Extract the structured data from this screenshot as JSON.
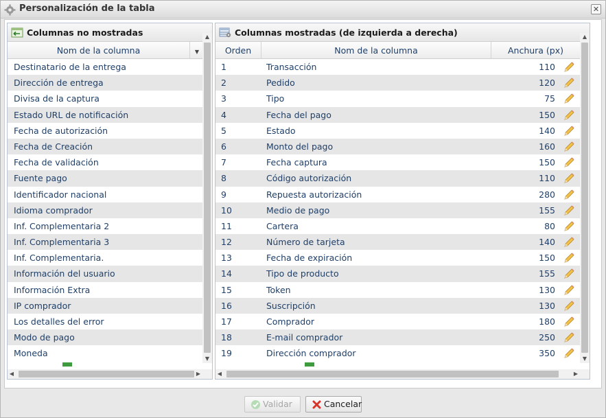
{
  "dialog": {
    "title": "Personalización de la tabla"
  },
  "hidden_panel": {
    "title": "Columnas no mostradas",
    "column_header": "Nom de la columna",
    "items": [
      "Destinatario de la entrega",
      "Dirección de entrega",
      "Divisa de la captura",
      "Estado URL de notificación",
      "Fecha de autorización",
      "Fecha de Creación",
      "Fecha de validación",
      "Fuente pago",
      "Identificador nacional",
      "Idioma comprador",
      "Inf. Complementaria 2",
      "Inf. Complementaria 3",
      "Inf. Complementaria.",
      "Información del usuario",
      "Información Extra",
      "IP comprador",
      "Los detalles del error",
      "Modo de pago",
      "Moneda"
    ]
  },
  "shown_panel": {
    "title": "Columnas mostradas (de izquierda a derecha)",
    "headers": {
      "order": "Orden",
      "name": "Nom de la columna",
      "width": "Anchura (px)"
    },
    "rows": [
      {
        "order": "1",
        "name": "Transacción",
        "width": "110"
      },
      {
        "order": "2",
        "name": "Pedido",
        "width": "120"
      },
      {
        "order": "3",
        "name": "Tipo",
        "width": "75"
      },
      {
        "order": "4",
        "name": "Fecha del pago",
        "width": "150"
      },
      {
        "order": "5",
        "name": "Estado",
        "width": "140"
      },
      {
        "order": "6",
        "name": "Monto del pago",
        "width": "160"
      },
      {
        "order": "7",
        "name": "Fecha captura",
        "width": "150"
      },
      {
        "order": "8",
        "name": "Código autorización",
        "width": "110"
      },
      {
        "order": "9",
        "name": "Repuesta autorización",
        "width": "280"
      },
      {
        "order": "10",
        "name": "Medio de pago",
        "width": "155"
      },
      {
        "order": "11",
        "name": "Cartera",
        "width": "80"
      },
      {
        "order": "12",
        "name": "Número de tarjeta",
        "width": "140"
      },
      {
        "order": "13",
        "name": "Fecha de expiración",
        "width": "150"
      },
      {
        "order": "14",
        "name": "Tipo de producto",
        "width": "155"
      },
      {
        "order": "15",
        "name": "Token",
        "width": "130"
      },
      {
        "order": "16",
        "name": "Suscripción",
        "width": "130"
      },
      {
        "order": "17",
        "name": "Comprador",
        "width": "180"
      },
      {
        "order": "18",
        "name": "E-mail comprador",
        "width": "250"
      },
      {
        "order": "19",
        "name": "Dirección comprador",
        "width": "350"
      }
    ]
  },
  "buttons": {
    "validate": "Validar",
    "cancel": "Cancelar"
  },
  "colors": {
    "text": "#1f3f68",
    "alt_row": "#e6e6e6",
    "cancel_icon": "#d9342b",
    "validate_icon": "#7fbf7f"
  }
}
